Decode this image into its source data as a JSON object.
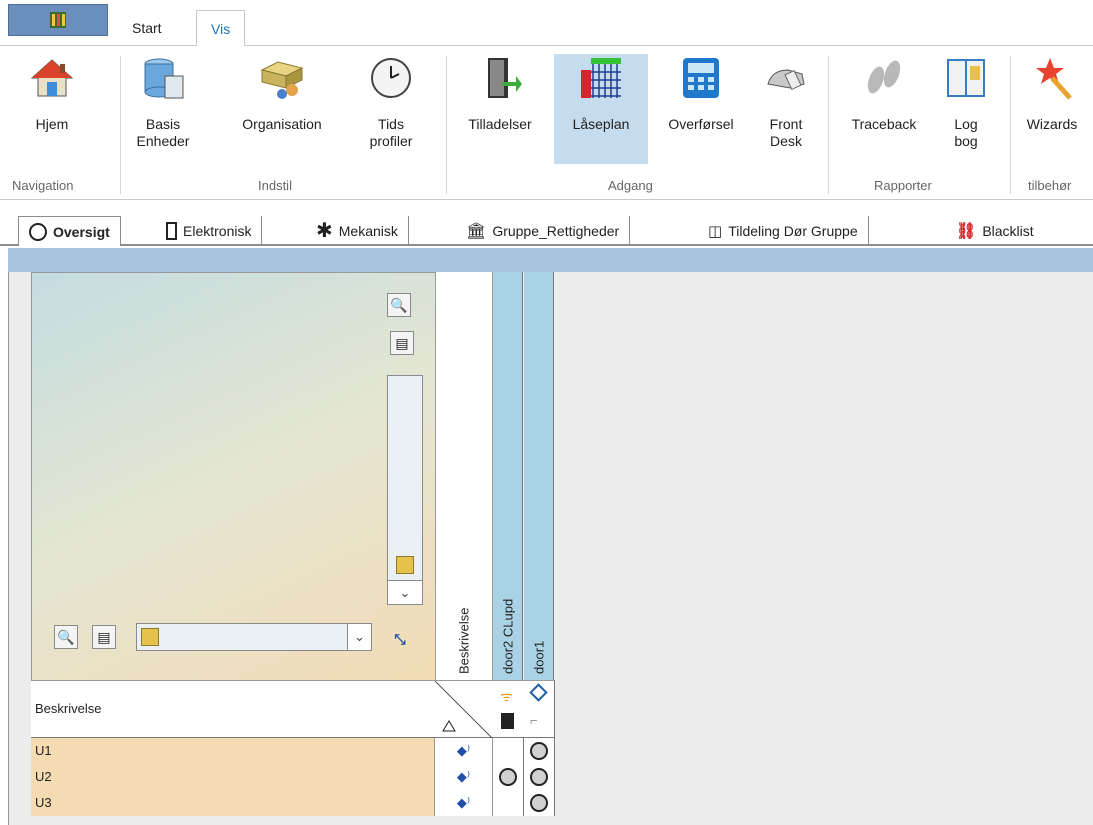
{
  "top_tabs": [
    "Start",
    "Vis"
  ],
  "ribbon": {
    "buttons": [
      {
        "label": "Hjem",
        "icon": "house-icon"
      },
      {
        "label": "Basis\nEnheder",
        "icon": "database-icon"
      },
      {
        "label": "Organisation",
        "icon": "organisation-icon"
      },
      {
        "label": "Tids\nprofiler",
        "icon": "clock-icon"
      },
      {
        "label": "Tilladelser",
        "icon": "door-icon"
      },
      {
        "label": "Låseplan",
        "icon": "lockplan-grid-icon"
      },
      {
        "label": "Overførsel",
        "icon": "calculator-icon"
      },
      {
        "label": "Front\nDesk",
        "icon": "key-hand-icon"
      },
      {
        "label": "Traceback",
        "icon": "footprints-icon"
      },
      {
        "label": "Log\nbog",
        "icon": "book-icon"
      },
      {
        "label": "Wizards",
        "icon": "magic-wand-icon"
      }
    ],
    "groups": [
      "Navigation",
      "Indstil",
      "Adgang",
      "Rapporter",
      "tilbehør"
    ]
  },
  "doc_tabs": [
    "Oversigt",
    "Elektronisk",
    "Mekanisk",
    "Gruppe_Rettigheder",
    "Tildeling Dør Gruppe",
    "Blacklist"
  ],
  "grid": {
    "desc_column": "Beskrivelse",
    "door_columns": [
      "door2 CLupd",
      "door1"
    ],
    "header_label": "Beskrivelse",
    "rows": [
      {
        "label": "U1",
        "door2": false,
        "door1": true
      },
      {
        "label": "U2",
        "door2": true,
        "door1": true
      },
      {
        "label": "U3",
        "door2": false,
        "door1": true
      }
    ]
  },
  "colors": {
    "active_ribbon": "#c5dcef",
    "row_bg": "#f5dbb1",
    "door_col": "#a9d3e4",
    "tab_accent": "#1f6fbf"
  }
}
